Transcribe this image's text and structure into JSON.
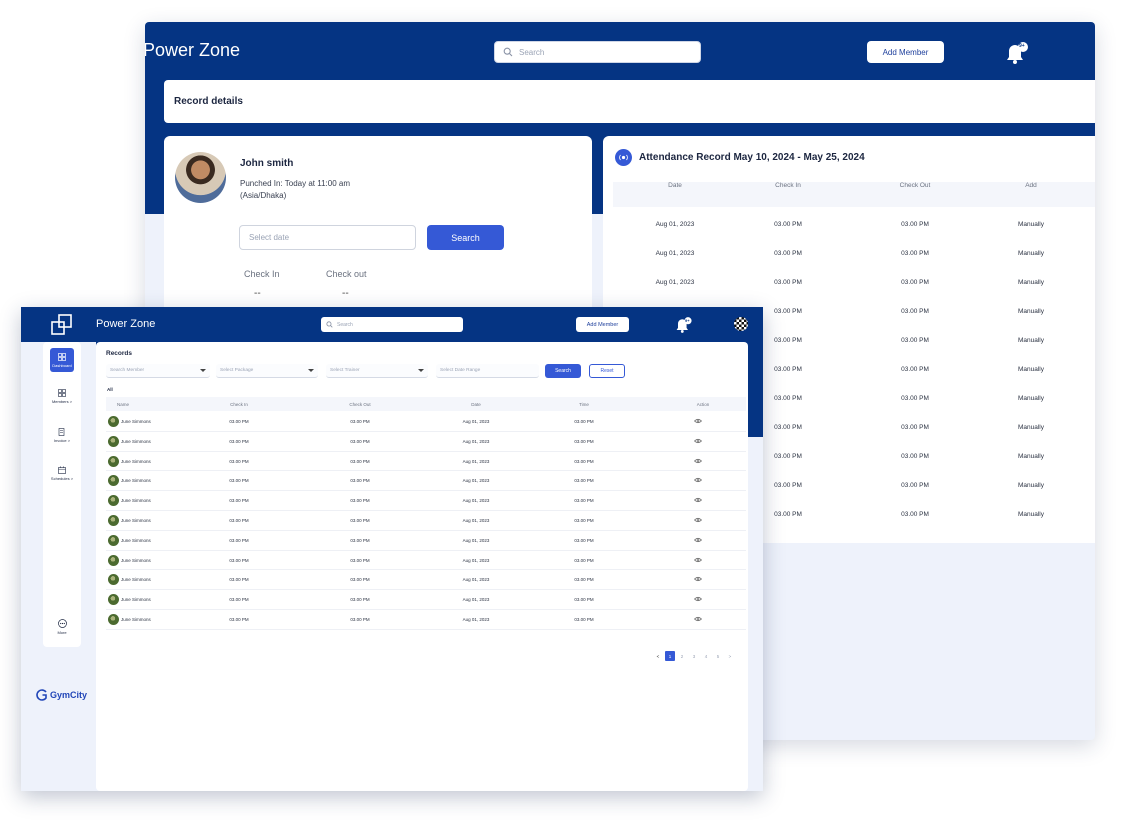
{
  "back_window": {
    "brand": "Power Zone",
    "search_placeholder": "Search",
    "add_member_label": "Add Member",
    "notification_badge": "9+",
    "record_details_title": "Record details",
    "profile": {
      "name": "John smith",
      "punched_in": "Punched In: Today at 11:00 am",
      "timezone": "(Asia/Dhaka)",
      "date_placeholder": "Select date",
      "search_label": "Search",
      "check_in_label": "Check In",
      "check_out_label": "Check out",
      "check_in_value": "--",
      "check_out_value": "--"
    },
    "attendance": {
      "title": "Attendance Record May 10, 2024 -  May 25, 2024",
      "columns": [
        "Date",
        "Check In",
        "Check Out",
        "Add"
      ],
      "rows": [
        [
          "Aug 01, 2023",
          "03.00 PM",
          "03.00 PM",
          "Manually"
        ],
        [
          "Aug 01, 2023",
          "03.00 PM",
          "03.00 PM",
          "Manually"
        ],
        [
          "Aug 01, 2023",
          "03.00 PM",
          "03.00 PM",
          "Manually"
        ],
        [
          "",
          "03.00 PM",
          "03.00 PM",
          "Manually"
        ],
        [
          "",
          "03.00 PM",
          "03.00 PM",
          "Manually"
        ],
        [
          "",
          "03.00 PM",
          "03.00 PM",
          "Manually"
        ],
        [
          "",
          "03.00 PM",
          "03.00 PM",
          "Manually"
        ],
        [
          "",
          "03.00 PM",
          "03.00 PM",
          "Manually"
        ],
        [
          "",
          "03.00 PM",
          "03.00 PM",
          "Manually"
        ],
        [
          "",
          "03.00 PM",
          "03.00 PM",
          "Manually"
        ],
        [
          "",
          "03.00 PM",
          "03.00 PM",
          "Manually"
        ]
      ]
    }
  },
  "front_window": {
    "brand": "Power Zone",
    "search_placeholder": "Search",
    "add_member_label": "Add Member",
    "notification_badge": "9+",
    "sidebar": {
      "items": [
        {
          "label": "Dashboard",
          "icon": "grid-icon",
          "active": true
        },
        {
          "label": "Members >",
          "icon": "members-icon",
          "active": false
        },
        {
          "label": "Invoice >",
          "icon": "invoice-icon",
          "active": false
        },
        {
          "label": "Schedules >",
          "icon": "calendar-icon",
          "active": false
        }
      ],
      "more_label": "More",
      "logo_text": "GymCity"
    },
    "records": {
      "title": "Records",
      "filters": {
        "member": "Search Member",
        "package": "Select Package",
        "trainer": "Select Trainer",
        "date_range": "Select Date Range"
      },
      "search_label": "Search",
      "reset_label": "Reset",
      "tab_all": "All",
      "columns": [
        "Name",
        "Check In",
        "Check Out",
        "Date",
        "Time",
        "Action"
      ],
      "rows": [
        [
          "June Simmons",
          "03.00 PM",
          "03.00 PM",
          "Aug 01, 2023",
          "03.00 PM"
        ],
        [
          "June Simmons",
          "03.00 PM",
          "03.00 PM",
          "Aug 01, 2023",
          "03.00 PM"
        ],
        [
          "June Simmons",
          "03.00 PM",
          "03.00 PM",
          "Aug 01, 2023",
          "03.00 PM"
        ],
        [
          "June Simmons",
          "03.00 PM",
          "03.00 PM",
          "Aug 01, 2023",
          "03.00 PM"
        ],
        [
          "June Simmons",
          "03.00 PM",
          "03.00 PM",
          "Aug 01, 2023",
          "03.00 PM"
        ],
        [
          "June Simmons",
          "03.00 PM",
          "03.00 PM",
          "Aug 01, 2023",
          "03.00 PM"
        ],
        [
          "June Simmons",
          "03.00 PM",
          "03.00 PM",
          "Aug 01, 2023",
          "03.00 PM"
        ],
        [
          "June Simmons",
          "03.00 PM",
          "03.00 PM",
          "Aug 01, 2023",
          "03.00 PM"
        ],
        [
          "June Simmons",
          "03.00 PM",
          "03.00 PM",
          "Aug 01, 2023",
          "03.00 PM"
        ],
        [
          "June Simmons",
          "03.00 PM",
          "03.00 PM",
          "Aug 01, 2023",
          "03.00 PM"
        ],
        [
          "June Simmons",
          "03.00 PM",
          "03.00 PM",
          "Aug 01, 2023",
          "03.00 PM"
        ]
      ],
      "pagination": {
        "prev": "<",
        "pages": [
          "1",
          "2",
          "3",
          "4",
          "5"
        ],
        "next": ">",
        "current": "1"
      }
    }
  },
  "colors": {
    "navy": "#053483",
    "accent": "#3559d6",
    "page_bg": "#eef2fb"
  }
}
